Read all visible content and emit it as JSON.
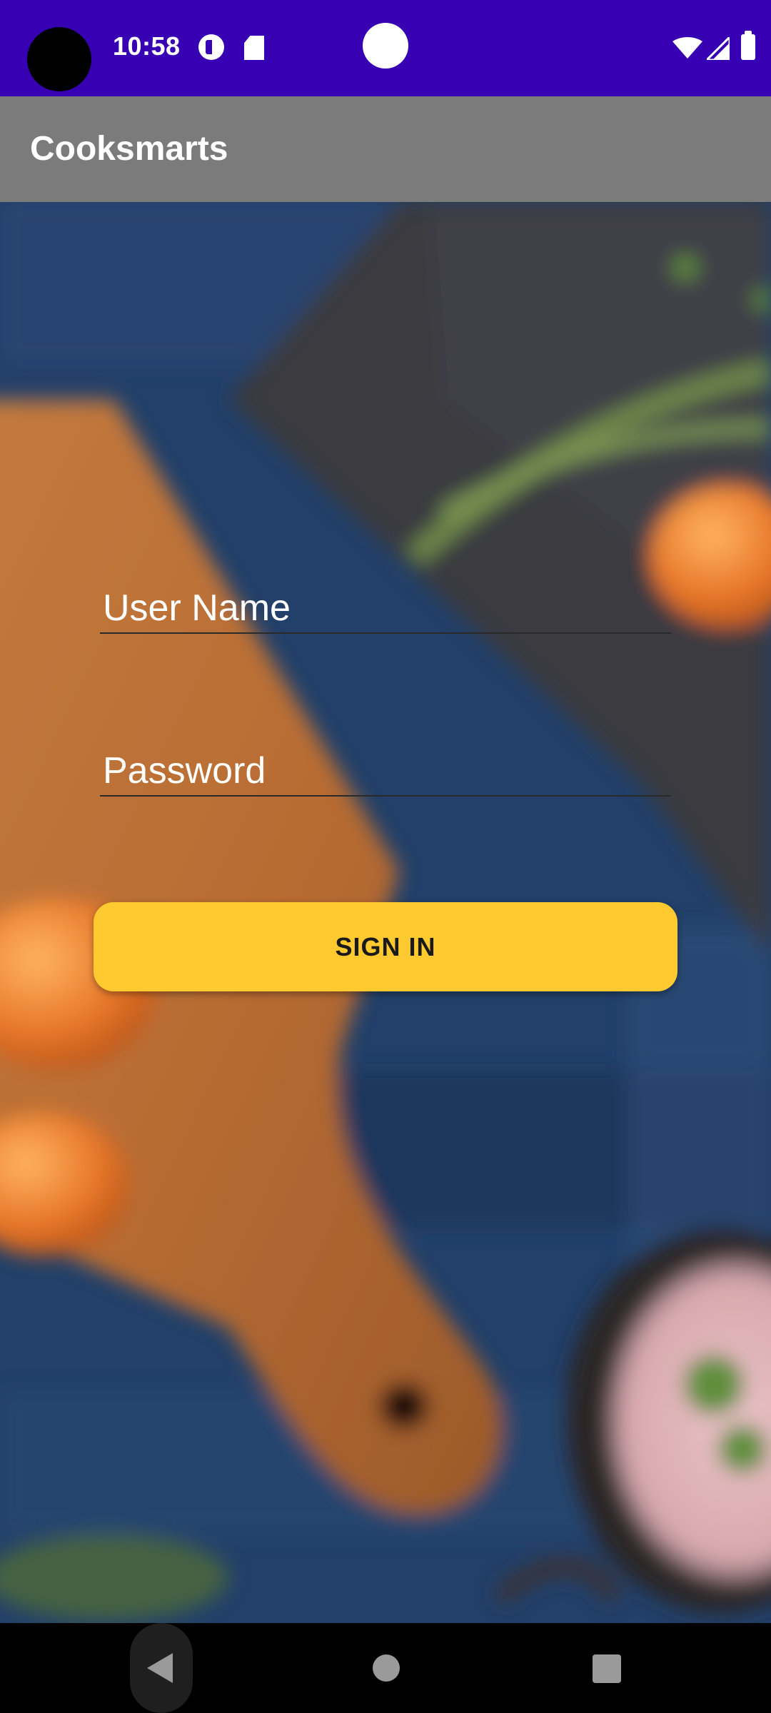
{
  "status_bar": {
    "time": "10:58",
    "color": "#3700b3",
    "icons": [
      "camera-cutout-icon",
      "app-notification-icon",
      "sd-card-icon",
      "notification-dot-icon",
      "wifi-icon",
      "cell-signal-icon",
      "battery-icon"
    ]
  },
  "app_bar": {
    "title": "Cooksmarts",
    "color": "#7b7b7b"
  },
  "login_form": {
    "username": {
      "placeholder": "User Name",
      "value": ""
    },
    "password": {
      "placeholder": "Password",
      "value": ""
    },
    "sign_in_label": "SIGN IN",
    "button_color": "#ffca2f"
  },
  "nav_bar": {
    "icons": [
      "back-icon",
      "home-icon",
      "recents-icon"
    ]
  }
}
